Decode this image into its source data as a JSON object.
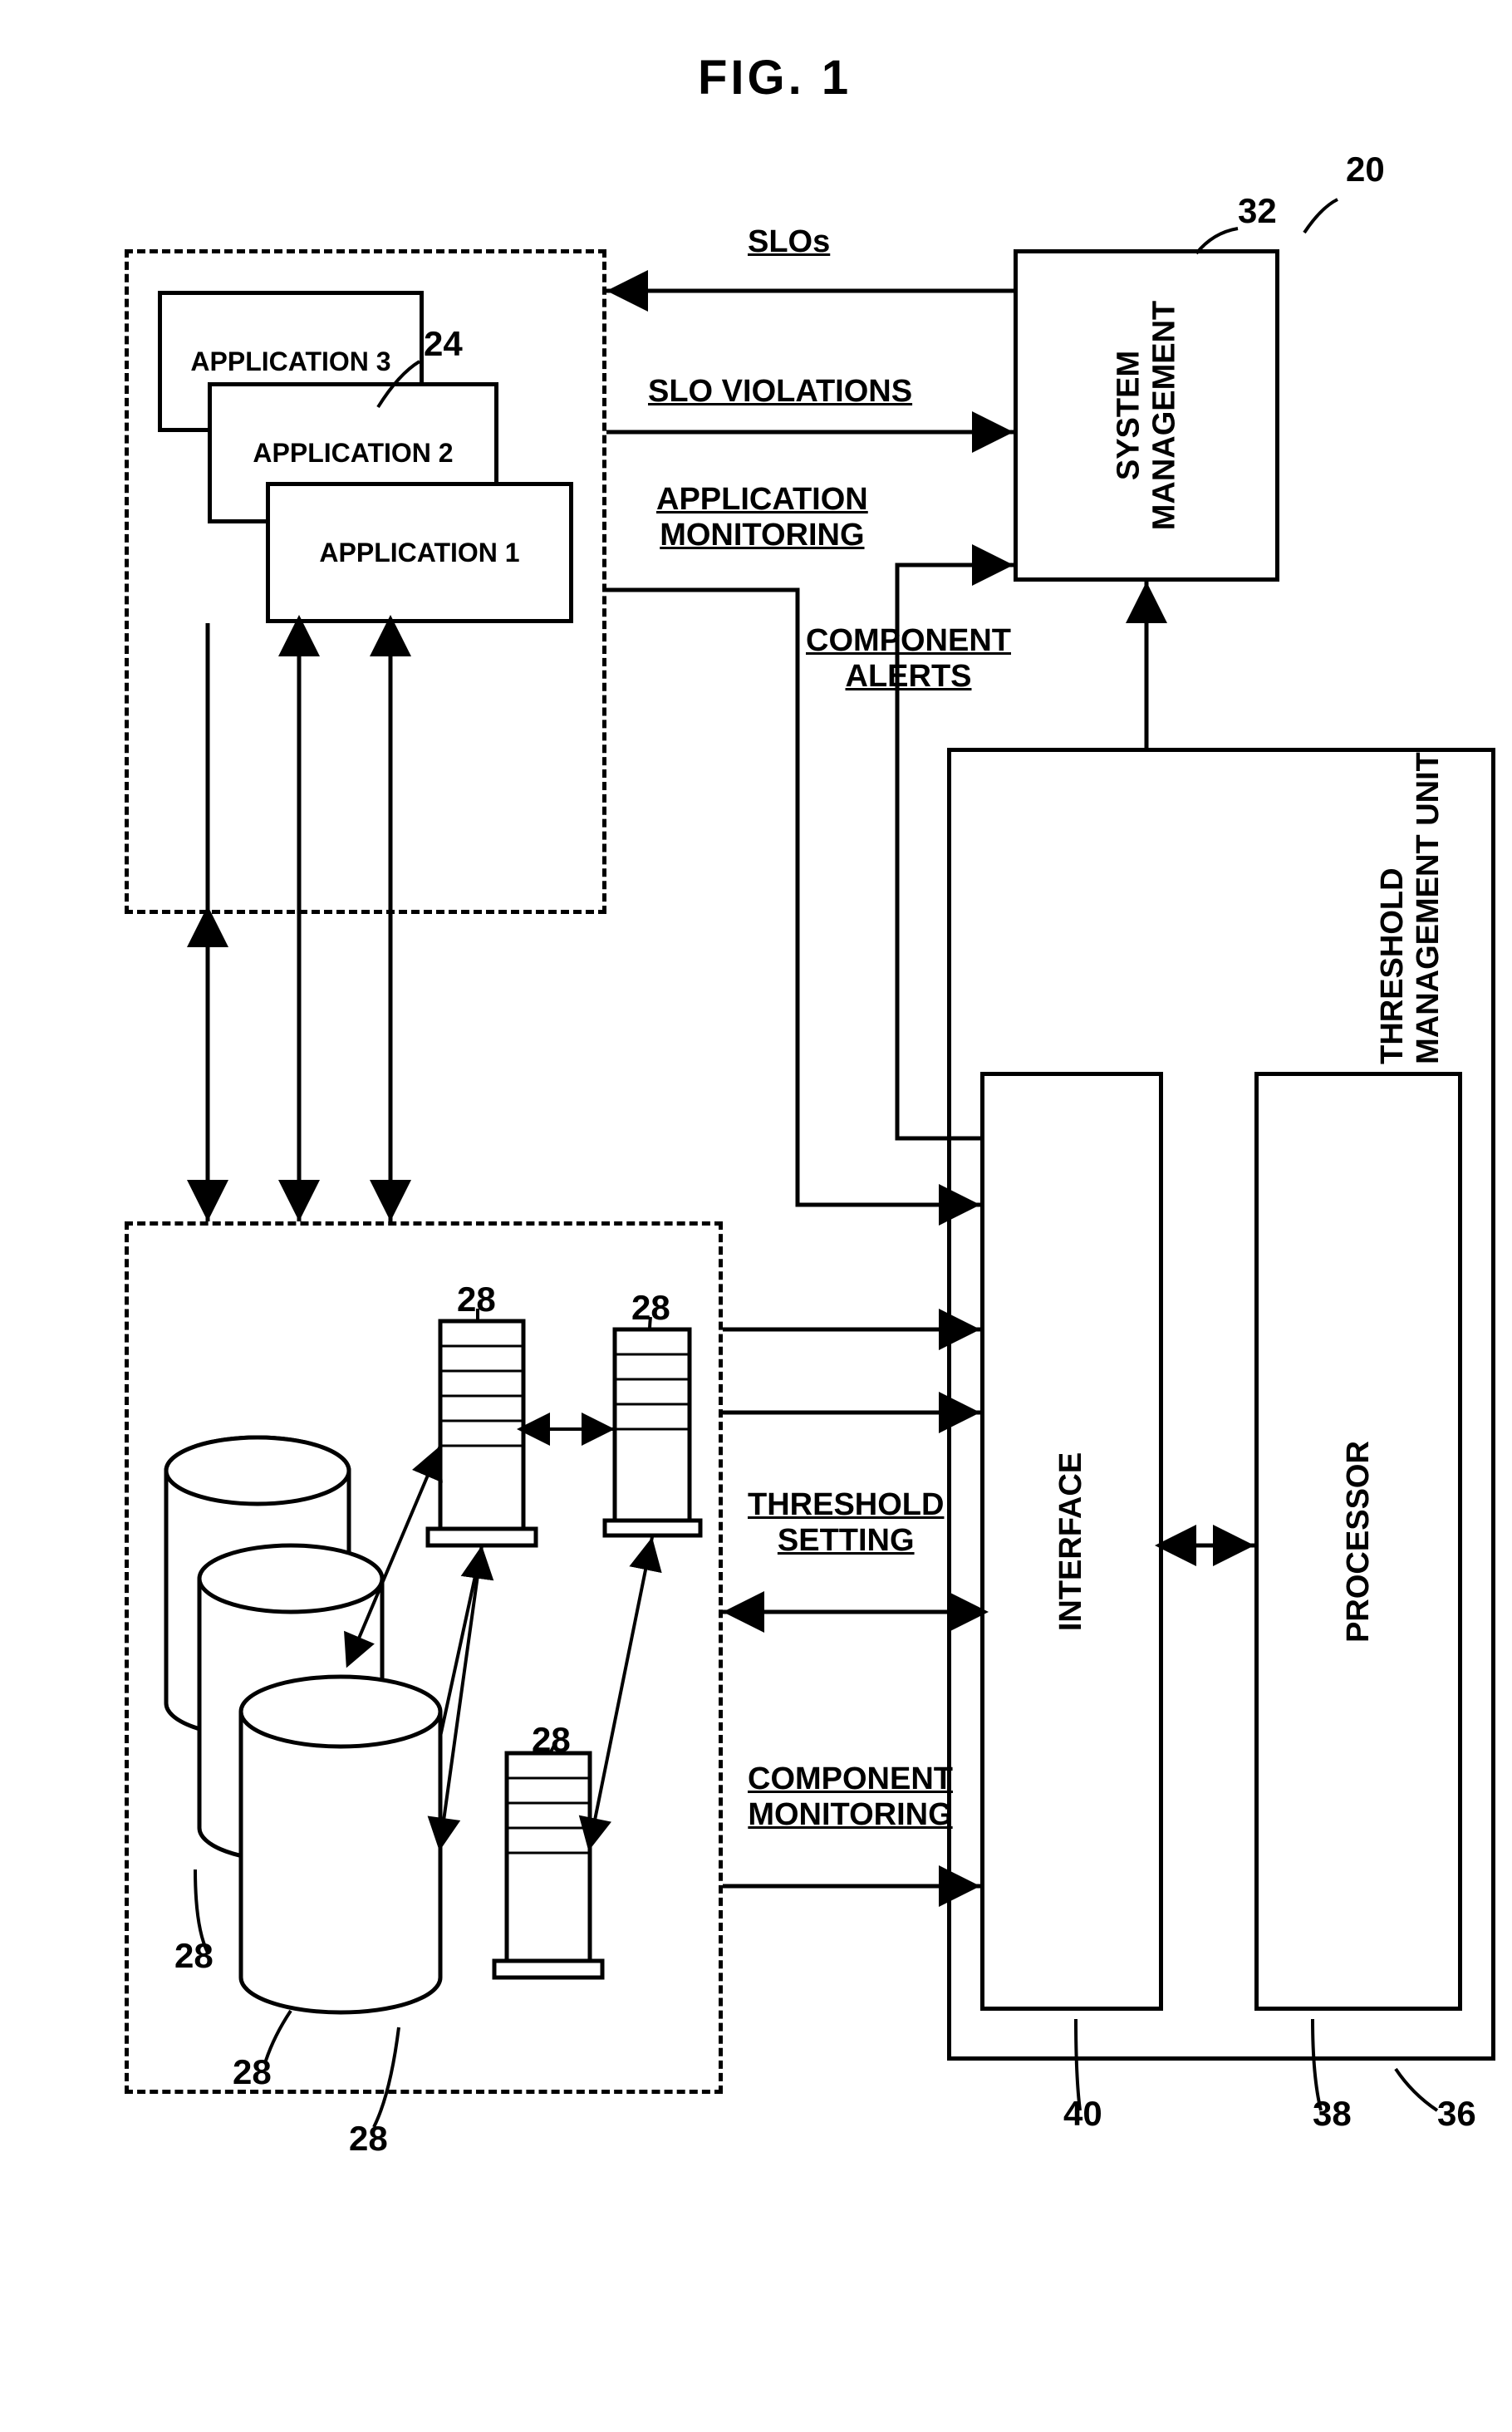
{
  "figure": {
    "title": "FIG. 1",
    "refs": {
      "r20": "20",
      "r24": "24",
      "r28a": "28",
      "r28b": "28",
      "r28c": "28",
      "r28d": "28",
      "r28e": "28",
      "r28f": "28",
      "r32": "32",
      "r36": "36",
      "r38": "38",
      "r40": "40"
    },
    "boxes": {
      "app1": "APPLICATION 1",
      "app2": "APPLICATION 2",
      "app3": "APPLICATION 3",
      "sysmgmt": "SYSTEM\nMANAGEMENT",
      "tmu": "THRESHOLD\nMANAGEMENT UNIT",
      "interface": "INTERFACE",
      "processor": "PROCESSOR"
    },
    "labels": {
      "slos": "SLOs",
      "slo_violations": "SLO VIOLATIONS",
      "app_monitoring": "APPLICATION\nMONITORING",
      "component_alerts": "COMPONENT\nALERTS",
      "threshold_setting": "THRESHOLD\nSETTING",
      "component_monitoring": "COMPONENT\nMONITORING"
    }
  }
}
